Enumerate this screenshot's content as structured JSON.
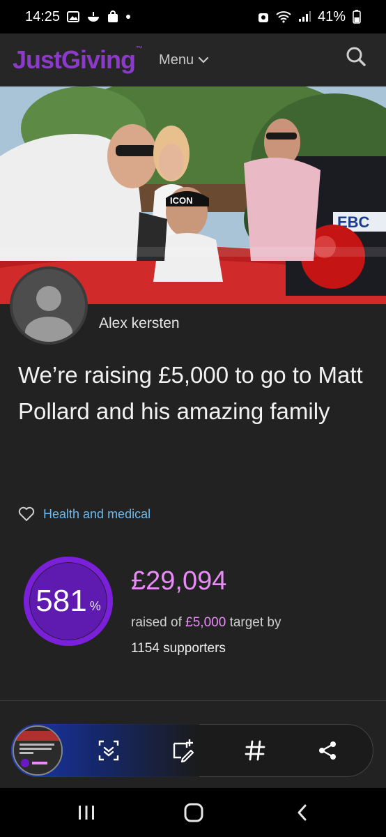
{
  "status_bar": {
    "time": "14:25",
    "battery": "41%"
  },
  "header": {
    "logo_text": "JustGiving",
    "logo_mark": "™",
    "menu_label": "Menu"
  },
  "page": {
    "owner_name": "Alex kersten",
    "title": "We’re raising £5,000 to go to Matt Pollard and his amazing family",
    "category": "Health and medical",
    "progress_value": "581",
    "progress_sign": "%",
    "progress_fraction": 1.0,
    "raised_amount": "£29,094",
    "raised_prefix": "raised of",
    "target_amount": "£5,000",
    "target_suffix": "target by",
    "supporters": "1154 supporters"
  },
  "colors": {
    "brand_purple": "#8c3ac9",
    "amount_pink": "#e98cf7",
    "link_blue": "#6db9ee",
    "ring_purple": "#6a18c9"
  }
}
